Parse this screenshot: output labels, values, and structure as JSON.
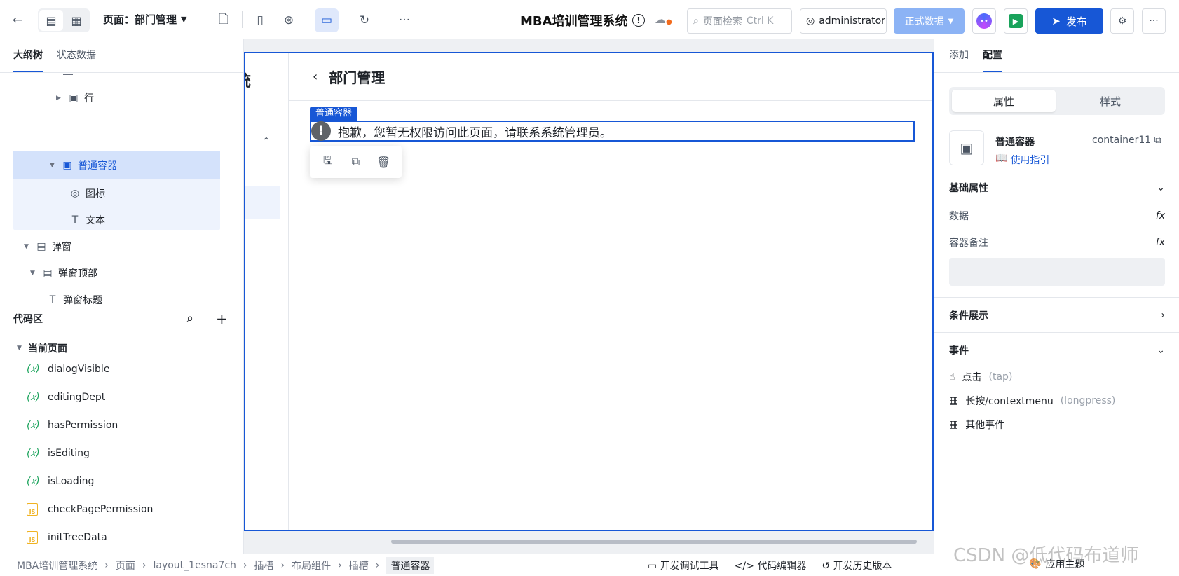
{
  "topbar": {
    "page_label": "页面：部门管理",
    "app_title": "MBA培训管理系统",
    "search_placeholder": "页面检索",
    "search_shortcut": "Ctrl K",
    "user": "administrator",
    "data_env": "正式数据",
    "publish": "发布"
  },
  "left": {
    "tabs": [
      "大纲树",
      "状态数据"
    ],
    "tree": [
      {
        "label": "行"
      },
      {
        "label": "普通容器"
      },
      {
        "label": "图标"
      },
      {
        "label": "文本"
      },
      {
        "label": "弹窗"
      },
      {
        "label": "弹窗顶部"
      },
      {
        "label": "弹窗标题"
      }
    ],
    "code_title": "代码区",
    "current_page": "当前页面",
    "code_items": [
      {
        "label": "dialogVisible",
        "kind": "var"
      },
      {
        "label": "editingDept",
        "kind": "var"
      },
      {
        "label": "hasPermission",
        "kind": "var"
      },
      {
        "label": "isEditing",
        "kind": "var"
      },
      {
        "label": "isLoading",
        "kind": "var"
      },
      {
        "label": "checkPagePermission",
        "kind": "js"
      },
      {
        "label": "initTreeData",
        "kind": "js"
      }
    ],
    "var_symbol": "(𝑥)",
    "js_symbol": "JS"
  },
  "canvas": {
    "partial_title": "统",
    "header_title": "部门管理",
    "selected_tag": "普通容器",
    "message": "抱歉，您暂无权限访问此页面，请联系系统管理员。"
  },
  "right": {
    "tabs": [
      "添加",
      "配置"
    ],
    "segments": [
      "属性",
      "样式"
    ],
    "component_name": "普通容器",
    "component_id": "container11",
    "guide": "使用指引",
    "basic_section": "基础属性",
    "data_label": "数据",
    "note_label": "容器备注",
    "fx": "fx",
    "condition_section": "条件展示",
    "events_section": "事件",
    "events": [
      {
        "name": "点击",
        "code": "(tap)"
      },
      {
        "name": "长按/contextmenu",
        "code": "(longpress)"
      },
      {
        "name": "其他事件",
        "code": ""
      }
    ]
  },
  "bottom": {
    "crumbs": [
      "MBA培训管理系统",
      "页面",
      "layout_1esna7ch",
      "插槽",
      "布局组件",
      "插槽",
      "普通容器"
    ],
    "tools": [
      "开发调试工具",
      "代码编辑器",
      "开发历史版本"
    ],
    "theme": "应用主题",
    "watermark": "CSDN @低代码布道师"
  }
}
